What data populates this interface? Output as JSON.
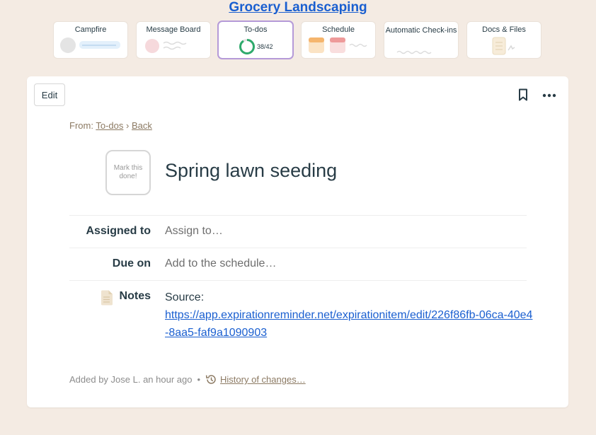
{
  "project": {
    "title": "Grocery Landscaping"
  },
  "tools": [
    {
      "name": "Campfire"
    },
    {
      "name": "Message Board"
    },
    {
      "name": "To-dos",
      "count": "38/42",
      "progress": 0.905
    },
    {
      "name": "Schedule"
    },
    {
      "name": "Automatic Check-ins"
    },
    {
      "name": "Docs & Files"
    }
  ],
  "toolbar": {
    "edit_label": "Edit"
  },
  "breadcrumb": {
    "prefix": "From:",
    "link1": "To-dos",
    "sep": "›",
    "link2": "Back"
  },
  "todo": {
    "mark_done_label": "Mark this done!",
    "title": "Spring lawn seeding",
    "assigned_label": "Assigned to",
    "assigned_placeholder": "Assign to…",
    "due_label": "Due on",
    "due_placeholder": "Add to the schedule…",
    "notes_label": "Notes",
    "notes_prefix": "Source:",
    "notes_link": "https://app.expirationreminder.net/expirationitem/edit/226f86fb-06ca-40e4-8aa5-faf9a1090903"
  },
  "footer": {
    "added_by": "Added by Jose L. an hour ago",
    "sep": "•",
    "history_link": "History of changes…"
  },
  "colors": {
    "link": "#1a5fd0",
    "accent": "#b59ad8",
    "progress": "#2eaa6c"
  }
}
